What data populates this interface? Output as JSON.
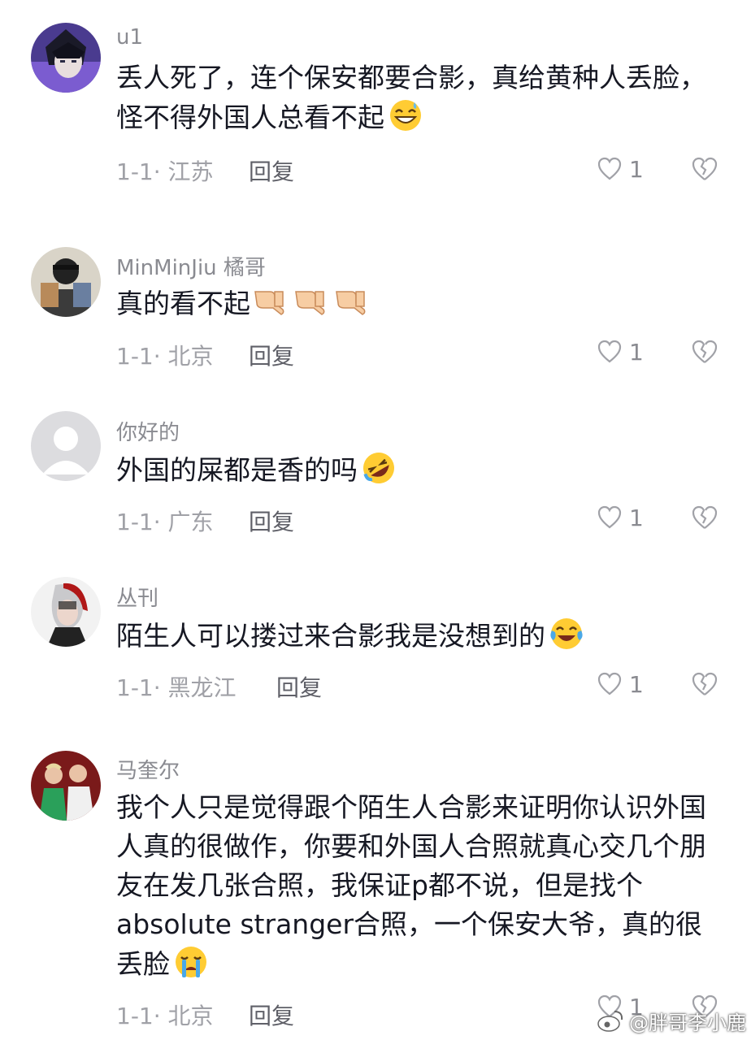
{
  "comments": [
    {
      "username": "u1",
      "text": "丢人死了，连个保安都要合影，真给黄种人丢脸，怪不得外国人总看不起",
      "emoji": "grinning-sweat-emoji",
      "meta": "1-1· 江苏",
      "reply": "回复",
      "likes": "1"
    },
    {
      "username": "MinMinJiu 橘哥",
      "text": "真的看不起",
      "emoji": "thumbs-down-emoji x3",
      "meta": "1-1· 北京",
      "reply": "回复",
      "likes": "1"
    },
    {
      "username": "你好的",
      "text": "外国的屎都是香的吗",
      "emoji": "rolling-laughing-emoji",
      "meta": "1-1· 广东",
      "reply": "回复",
      "likes": "1"
    },
    {
      "username": "丛刊",
      "text": "陌生人可以搂过来合影我是没想到的",
      "emoji": "tears-of-joy-emoji",
      "meta": "1-1· 黑龙江",
      "reply": "回复",
      "likes": "1"
    },
    {
      "username": "马奎尔",
      "text": "我个人只是觉得跟个陌生人合影来证明你认识外国人真的很做作，你要和外国人合照就真心交几个朋友在发几张合照，我保证p都不说，但是找个absolute stranger合照，一个保安大爷，真的很丢脸",
      "emoji": "crying-emoji",
      "meta": "1-1· 北京",
      "reply": "回复",
      "likes": "1"
    }
  ],
  "watermark": "@胖哥李小鹿",
  "colors": {
    "text": "#161823",
    "secondary": "#8a8b91",
    "meta": "#a0a1a7",
    "background": "#ffffff"
  }
}
